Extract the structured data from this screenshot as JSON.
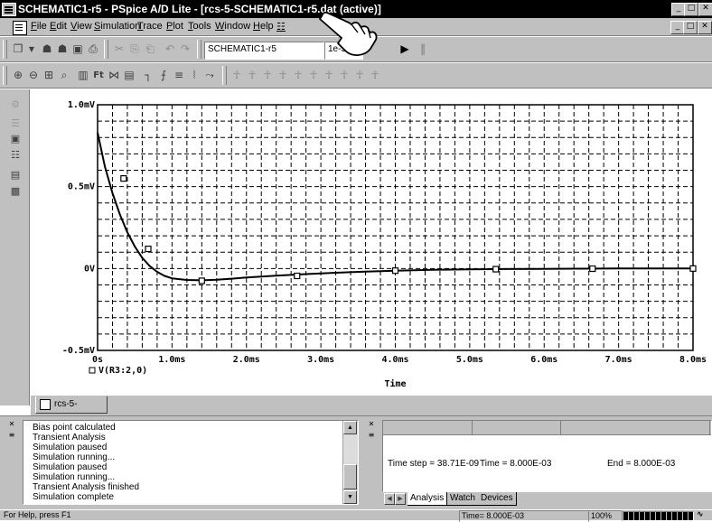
{
  "window": {
    "title": "SCHEMATIC1-r5 - PSpice A/D Lite  - [rcs-5-SCHEMATIC1-r5.dat (active)]",
    "controls": [
      "minimize",
      "restore",
      "close"
    ],
    "doc_controls": [
      "minimize",
      "restore",
      "close"
    ]
  },
  "menu": {
    "items": [
      "File",
      "Edit",
      "View",
      "Simulation",
      "Trace",
      "Plot",
      "Tools",
      "Window",
      "Help"
    ]
  },
  "toolbar1": {
    "profile_value": "SCHEMATIC1-r5",
    "run_value": "1e-3"
  },
  "chart_data": {
    "type": "line",
    "title": "",
    "xlabel": "Time",
    "ylabel": "",
    "xlim": [
      0,
      8.0
    ],
    "ylim": [
      -0.5,
      1.0
    ],
    "x_unit": "ms",
    "y_unit": "mV",
    "x_ticks": [
      "0s",
      "1.0ms",
      "2.0ms",
      "3.0ms",
      "4.0ms",
      "5.0ms",
      "6.0ms",
      "7.0ms",
      "8.0ms"
    ],
    "y_ticks": [
      "-0.5mV",
      "0V",
      "0.5mV",
      "1.0mV"
    ],
    "grid": true,
    "legend_position": "bottom-left",
    "series": [
      {
        "name": "V(R3:2,0)",
        "marker": "square",
        "x": [
          0,
          0.1,
          0.2,
          0.3,
          0.4,
          0.5,
          0.6,
          0.7,
          0.8,
          0.9,
          1.0,
          1.2,
          1.4,
          1.6,
          1.8,
          2.0,
          2.4,
          2.8,
          3.2,
          3.6,
          4.0,
          4.5,
          5.0,
          5.5,
          6.0,
          6.5,
          7.0,
          7.5,
          8.0
        ],
        "y": [
          0.83,
          0.62,
          0.46,
          0.33,
          0.22,
          0.135,
          0.065,
          0.015,
          -0.02,
          -0.045,
          -0.06,
          -0.07,
          -0.072,
          -0.068,
          -0.062,
          -0.055,
          -0.044,
          -0.034,
          -0.026,
          -0.019,
          -0.013,
          -0.008,
          -0.005,
          -0.003,
          -0.002,
          -0.001,
          0.0,
          0.0,
          0.0
        ],
        "marker_x": [
          0.35,
          0.68,
          1.4,
          2.68,
          4.0,
          5.35,
          6.65,
          8.0
        ],
        "marker_y": [
          0.55,
          0.12,
          -0.075,
          -0.045,
          -0.013,
          -0.004,
          -0.001,
          0.0
        ]
      }
    ]
  },
  "sheet_tab": {
    "label": "rcs-5-SCHE..."
  },
  "output": {
    "lines": [
      "Bias point calculated",
      "Transient Analysis",
      "Simulation paused",
      "Simulation running...",
      "Simulation paused",
      "Simulation running...",
      "Transient Analysis finished",
      "Simulation complete"
    ]
  },
  "sim_status": {
    "time_step": "Time step = 38.71E-09",
    "time": "Time = 8.000E-03",
    "end": "End = 8.000E-03",
    "tabs": [
      "Analysis",
      "Watch",
      "Devices"
    ],
    "active_tab": "Analysis"
  },
  "statusbar": {
    "help": "For Help, press F1",
    "time": "Time= 8.000E-03",
    "zoom": "100%",
    "progress": 1.0
  },
  "colors": {
    "titlebar": "#000000",
    "chrome": "#c0c0c0",
    "plot_background": "#ffffff",
    "trace": "#000000"
  }
}
